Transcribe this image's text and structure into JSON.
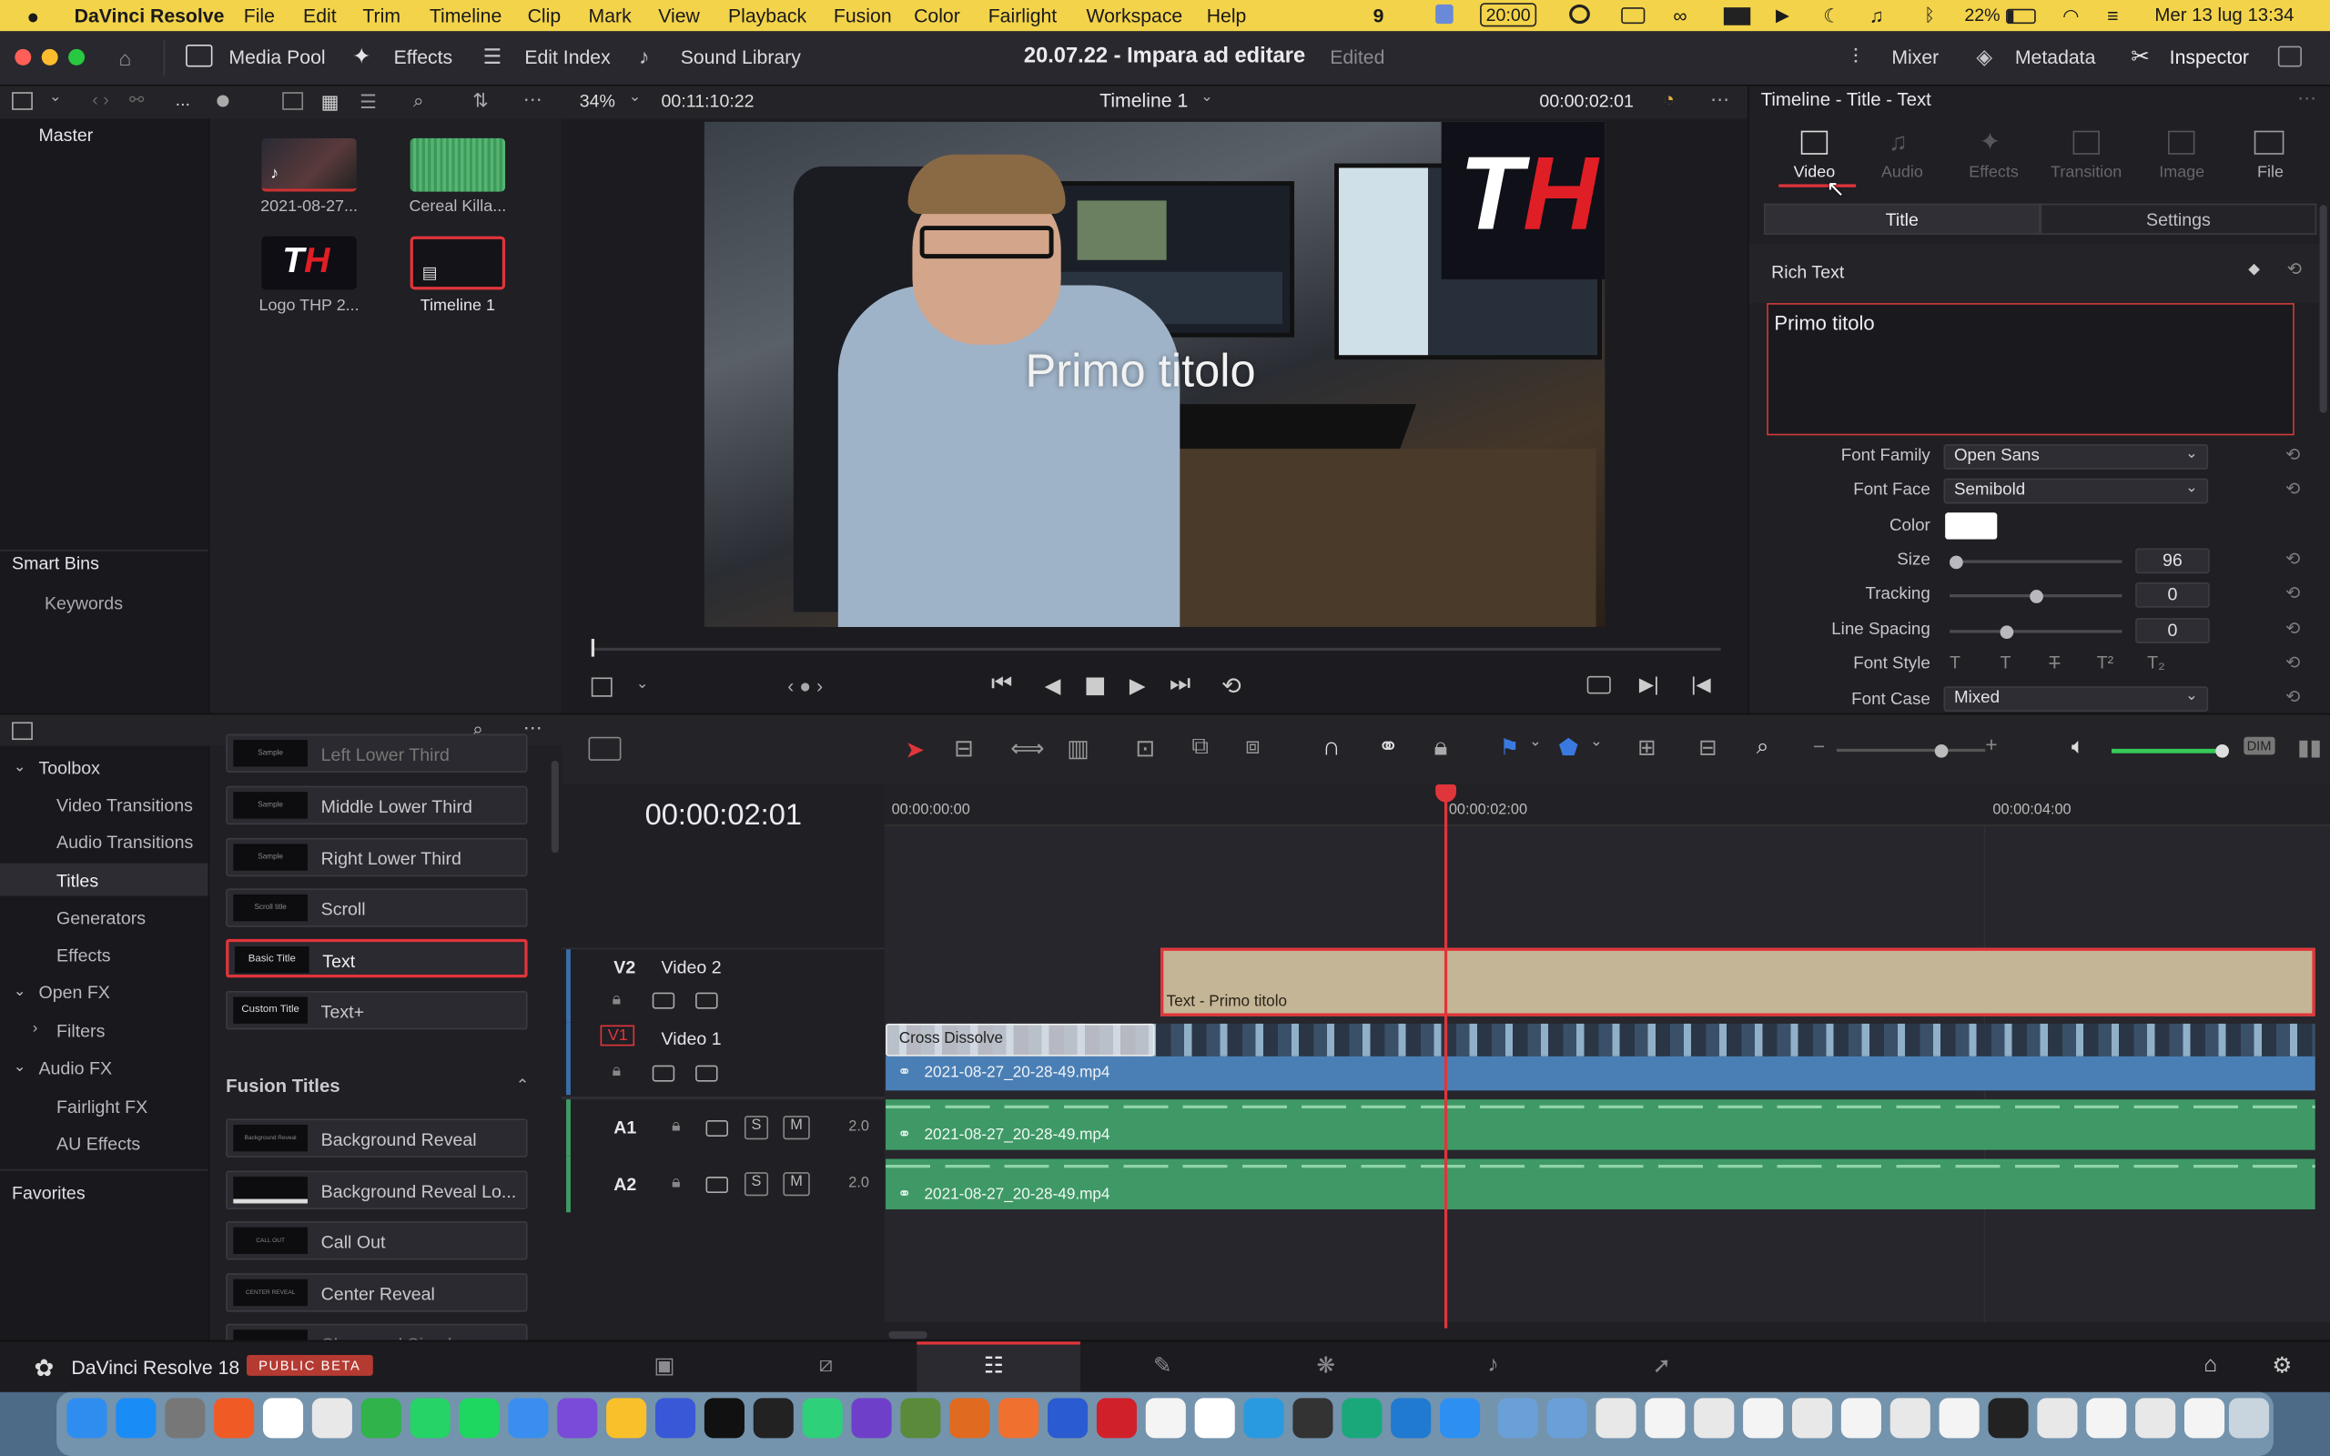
{
  "menubar": {
    "apple": "",
    "items": [
      "DaVinci Resolve",
      "File",
      "Edit",
      "Trim",
      "Timeline",
      "Clip",
      "Mark",
      "View",
      "Playback",
      "Fusion",
      "Color",
      "Fairlight",
      "Workspace",
      "Help"
    ],
    "status": {
      "notif": "9",
      "clock": "20:00",
      "battery": "22%",
      "datetime": "Mer 13 lug  13:34"
    }
  },
  "toolbar": {
    "media_pool": "Media Pool",
    "effects": "Effects",
    "edit_index": "Edit Index",
    "sound_library": "Sound Library",
    "project_title": "20.07.22 - Impara ad editare",
    "project_status": "Edited",
    "mixer": "Mixer",
    "metadata": "Metadata",
    "inspector": "Inspector"
  },
  "viewer_bar": {
    "more": "...",
    "zoom": "34%",
    "source_tc": "00:11:10:22",
    "timeline_name": "Timeline 1",
    "record_tc": "00:00:02:01"
  },
  "media_pool": {
    "bin": "Master",
    "clips": [
      {
        "label": "2021-08-27..."
      },
      {
        "label": "Cereal Killa..."
      },
      {
        "label": "Logo THP 2..."
      },
      {
        "label": "Timeline 1"
      }
    ],
    "smart_bins": "Smart Bins",
    "keywords": "Keywords"
  },
  "viewer": {
    "title_overlay": "Primo titolo",
    "logo_text": "TH"
  },
  "inspector": {
    "header": "Timeline - Title - Text",
    "tabs": [
      {
        "label": "Video"
      },
      {
        "label": "Audio"
      },
      {
        "label": "Effects"
      },
      {
        "label": "Transition"
      },
      {
        "label": "Image"
      },
      {
        "label": "File"
      }
    ],
    "subtabs": {
      "title": "Title",
      "settings": "Settings"
    },
    "section": "Rich Text",
    "text_value": "Primo titolo",
    "fields": {
      "font_family_label": "Font Family",
      "font_family": "Open Sans",
      "font_face_label": "Font Face",
      "font_face": "Semibold",
      "color_label": "Color",
      "color": "#ffffff",
      "size_label": "Size",
      "size": "96",
      "tracking_label": "Tracking",
      "tracking": "0",
      "line_spacing_label": "Line Spacing",
      "line_spacing": "0",
      "font_style_label": "Font Style",
      "font_case_label": "Font Case",
      "font_case": "Mixed"
    }
  },
  "effects_library": {
    "toolbox": "Toolbox",
    "items": [
      "Video Transitions",
      "Audio Transitions",
      "Titles",
      "Generators",
      "Effects"
    ],
    "open_fx": "Open FX",
    "filters": "Filters",
    "audio_fx": "Audio FX",
    "fairlight_fx": "Fairlight FX",
    "au_effects": "AU Effects",
    "favorites": "Favorites",
    "titles": [
      {
        "thumb": "Sample",
        "label": "Left Lower Third"
      },
      {
        "thumb": "Sample",
        "label": "Middle Lower Third"
      },
      {
        "thumb": "Sample",
        "label": "Right Lower Third"
      },
      {
        "thumb": "Scroll title",
        "label": "Scroll"
      },
      {
        "thumb": "Basic Title",
        "label": "Text"
      },
      {
        "thumb": "Custom Title",
        "label": "Text+"
      }
    ],
    "fusion_header": "Fusion Titles",
    "fusion": [
      {
        "thumb": "Background Reveal",
        "label": "Background Reveal"
      },
      {
        "thumb": "",
        "label": "Background Reveal Lo..."
      },
      {
        "thumb": "CALL OUT",
        "label": "Call Out"
      },
      {
        "thumb": "CENTER REVEAL",
        "label": "Center Reveal"
      },
      {
        "thumb": "SAMPLE",
        "label": "Clean and Simple"
      }
    ]
  },
  "timeline": {
    "timecode": "00:00:02:01",
    "ruler": [
      "00:00:00:00",
      "00:00:02:00",
      "00:00:04:00"
    ],
    "tracks": {
      "v2_id": "V2",
      "v2_name": "Video 2",
      "v1_id": "V1",
      "v1_name": "Video 1",
      "a1_id": "A1",
      "a2_id": "A2",
      "a_ch": "2.0",
      "solo": "S",
      "mute": "M"
    },
    "title_clip": "Text - Primo titolo",
    "transition": "Cross Dissolve",
    "video_clip": "2021-08-27_20-28-49.mp4",
    "audio_clip1": "2021-08-27_20-28-49.mp4",
    "audio_clip2": "2021-08-27_20-28-49.mp4"
  },
  "bottom": {
    "app_name": "DaVinci Resolve 18",
    "badge": "PUBLIC BETA"
  }
}
